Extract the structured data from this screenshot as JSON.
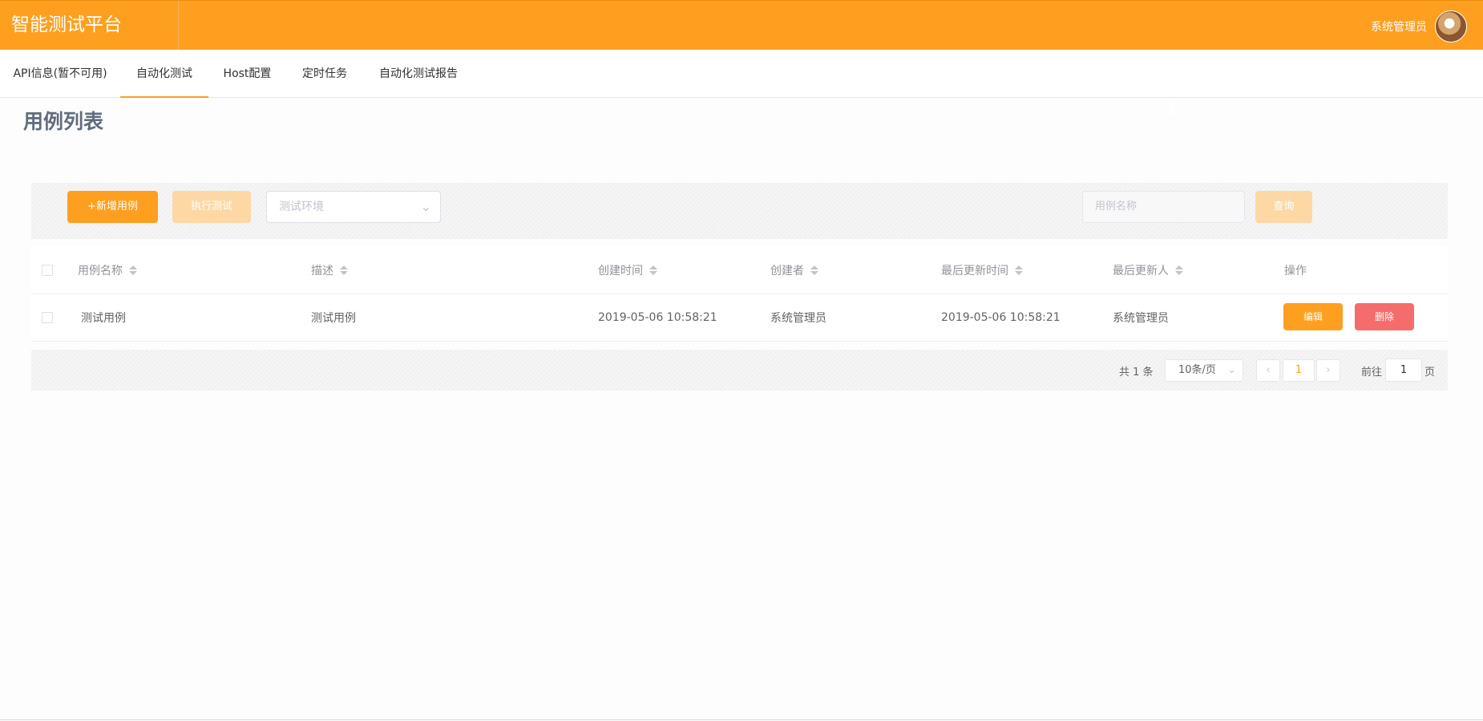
{
  "header": {
    "brand": "智能测试平台",
    "user_name": "系统管理员"
  },
  "nav": {
    "items": [
      {
        "label": "API信息(暂不可用)",
        "active": false
      },
      {
        "label": "自动化测试",
        "active": true
      },
      {
        "label": "Host配置",
        "active": false
      },
      {
        "label": "定时任务",
        "active": false
      },
      {
        "label": "自动化测试报告",
        "active": false
      }
    ]
  },
  "page": {
    "title": "用例列表"
  },
  "toolbar": {
    "add_label": "+新增用例",
    "run_label": "执行测试",
    "env_placeholder": "测试环境",
    "search_placeholder": "用例名称",
    "query_label": "查询"
  },
  "table": {
    "columns": [
      "用例名称",
      "描述",
      "创建时间",
      "创建者",
      "最后更新时间",
      "最后更新人",
      "操作"
    ],
    "rows": [
      {
        "name": "测试用例",
        "description": "测试用例",
        "created_at": "2019-05-06 10:58:21",
        "creator": "系统管理员",
        "updated_at": "2019-05-06 10:58:21",
        "updater": "系统管理员",
        "edit_label": "编辑",
        "delete_label": "删除"
      }
    ]
  },
  "pagination": {
    "total": "共 1 条",
    "page_size": "10条/页",
    "current_page": "1",
    "goto_label": "前往",
    "goto_value": "1",
    "goto_unit": "页"
  },
  "icons": {
    "dropdown": "chevron-down-icon",
    "prev": "chevron-left-icon",
    "next": "chevron-right-icon",
    "sort": "sort-icon"
  },
  "colors": {
    "primary": "#ff9f1f",
    "danger": "#f56c6c"
  }
}
